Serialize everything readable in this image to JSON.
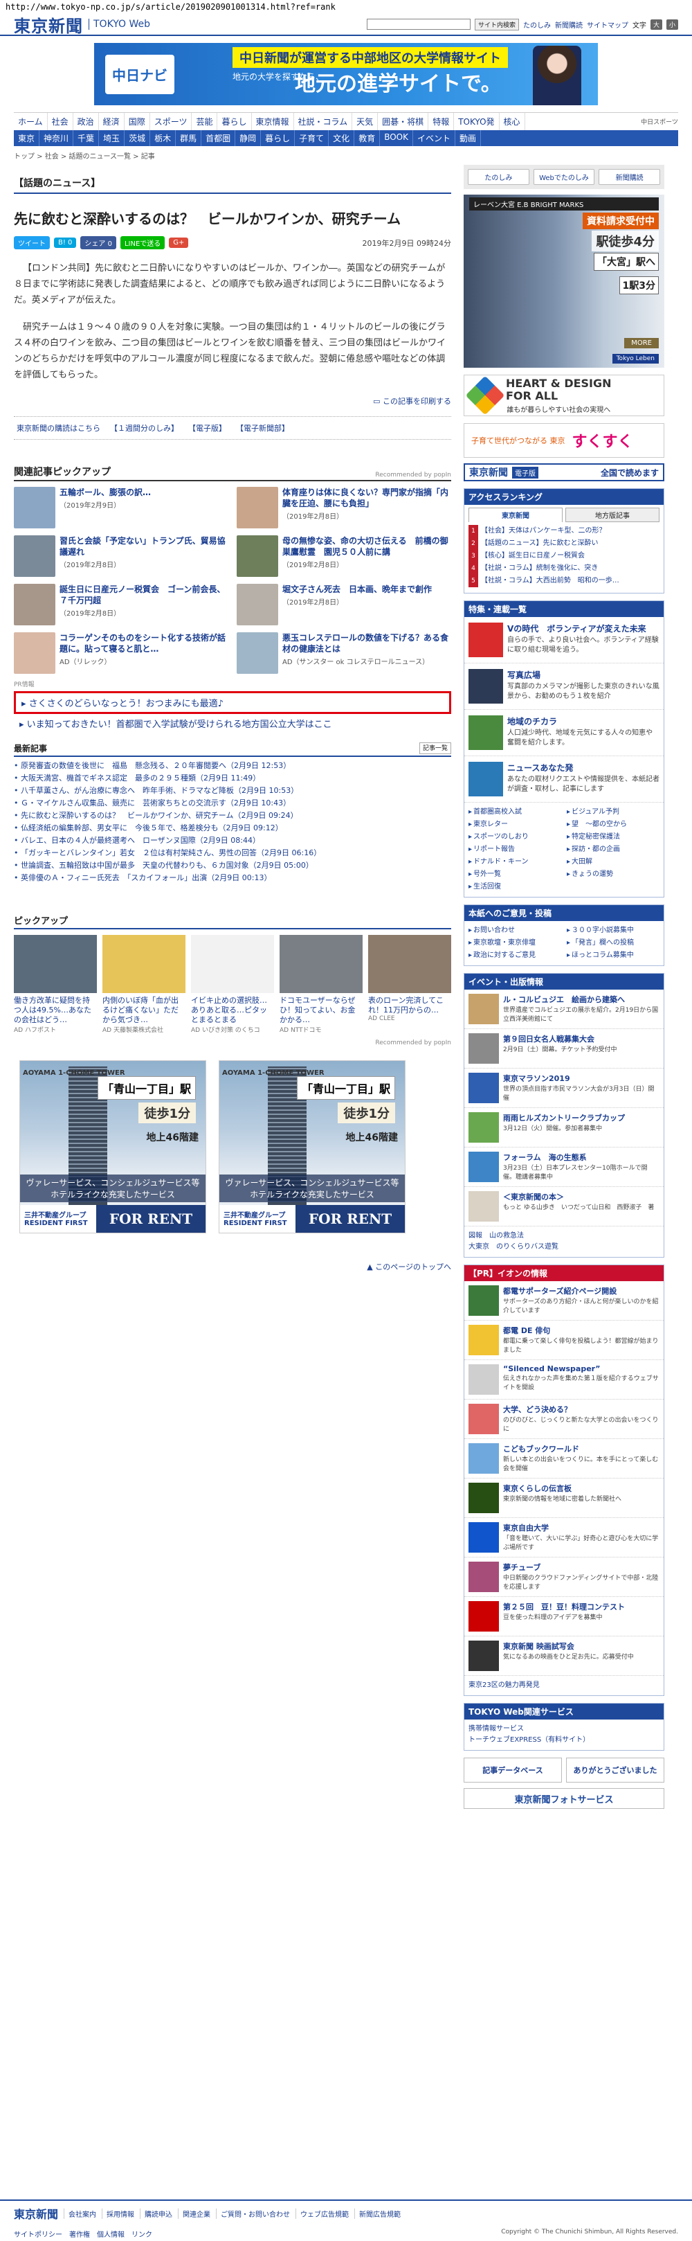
{
  "url": "http://www.tokyo-np.co.jp/s/article/2019020901001314.html?ref=rank",
  "header": {
    "logo": "東京新聞",
    "logo_web": "TOKYO Web",
    "search_button": "サイト内検索",
    "links": [
      "たのしみ",
      "新聞購読",
      "サイトマップ"
    ],
    "font_label": "文字",
    "font_large": "大",
    "font_small": "小"
  },
  "top_ad": {
    "logo": "中日ナビ",
    "headline": "中日新聞が運営する中部地区の大学情報サイト",
    "small": "地元の大学を探すなら、",
    "main": "地元の進学サイトで。"
  },
  "nav_primary": [
    "ホーム",
    "社会",
    "政治",
    "経済",
    "国際",
    "スポーツ",
    "芸能",
    "暮らし",
    "東京情報",
    "社説・コラム",
    "天気",
    "囲碁・将棋",
    "特報",
    "TOKYO発",
    "核心"
  ],
  "nav_primary_right": "中日スポーツ",
  "nav_secondary": [
    "東京",
    "神奈川",
    "千葉",
    "埼玉",
    "茨城",
    "栃木",
    "群馬",
    "首都圏",
    "静岡",
    "暮らし",
    "子育て",
    "文化",
    "教育",
    "BOOK",
    "イベント",
    "動画"
  ],
  "breadcrumb": "トップ > 社会 > 話題のニュース一覧 > 記事",
  "section": "【話題のニュース】",
  "article": {
    "title": "先に飲むと深酔いするのは？　ビールかワインか、研究チーム",
    "date": "2019年2月9日 09時24分",
    "paragraphs": [
      "【ロンドン共同】先に飲むと二日酔いになりやすいのはビールか、ワインか―。英国などの研究チームが８日までに学術誌に発表した調査結果によると、どの順序でも飲み過ぎれば同じように二日酔いになるようだ。英メディアが伝えた。",
      "研究チームは１９～４０歳の９０人を対象に実験。一つ目の集団は約１・４リットルのビールの後にグラス４杯の白ワインを飲み、二つ目の集団はビールとワインを飲む順番を替え、三つ目の集団はビールかワインのどちらかだけを呼気中のアルコール濃度が同じ程度になるまで飲んだ。翌朝に倦怠感や嘔吐などの体調を評価してもらった。"
    ],
    "print": "この記事を印刷する"
  },
  "share": {
    "tweet": "ツイート",
    "hatena": "B! 0",
    "facebook": "シェア 0",
    "line": "LINEで送る",
    "gplus": "G+"
  },
  "sub_links": [
    "東京新聞の購読はこちら",
    "【１週間分のしみ】",
    "【電子版】",
    "【電子新聞部】"
  ],
  "related": {
    "title": "関連記事ピックアップ",
    "recommend": "Recommended by popIn",
    "items": [
      {
        "title": "五輪ボール、膨張の訳…",
        "date": "（2019年2月9日）"
      },
      {
        "title": "体育座りは体に良くない？専門家が指摘「内臓を圧迫、腰にも負担」",
        "date": "（2019年2月8日）"
      },
      {
        "title": "習氏と会談「予定ない」トランプ氏、貿易協議遅れ",
        "date": "（2019年2月8日）"
      },
      {
        "title": "母の無惨な姿、命の大切さ伝える　前橋の御巣鷹慰霊　園児５０人前に講",
        "date": "（2019年2月8日）"
      },
      {
        "title": "誕生日に日産元ノー税質会　ゴーン前会長、７千万円超",
        "date": "（2019年2月8日）"
      },
      {
        "title": "堀文子さん死去　日本画、晩年まで創作",
        "date": "（2019年2月8日）"
      },
      {
        "title": "コラーゲンそのものをシート化する技術が話題に。貼って寝ると肌と…",
        "date": "AD（リレック）"
      },
      {
        "title": "悪玉コレステロールの数値を下げる？ある食材の健康法とは",
        "date": "AD（サンスター ok コレステロールニュース）"
      }
    ]
  },
  "pr": {
    "label": "PR情報",
    "line1": "さくさくのどらいなっとう！おつまみにも最適♪",
    "line2": "いま知っておきたい！首都圏で入学試験が受けられる地方国公立大学はここ"
  },
  "latest": {
    "title": "最新記事",
    "more": "記事一覧",
    "items": [
      "原発審査の数値を後世に　福島　懸念残る、２０年審閲要へ（2月9日 12:53）",
      "大阪天満宮、機首でギネス認定　最多の２９５種類（2月9日 11:49）",
      "八千草薫さん、がん治療に専念へ　昨年手術、ドラマなど降板（2月9日 10:53）",
      "Ｇ・マイケルさん収集品、競売に　芸術家ちちとの交流示す（2月9日 10:43）",
      "先に飲むと深酔いするのは？　ビールかワインか、研究チーム（2月9日 09:24）",
      "仏経済紙の編集幹部、男女平に　今後５年で、格差検分も（2月9日 09:12）",
      "バレエ、日本の４人が最終選考へ　ローザンヌ国際（2月9日 08:44）",
      "「ガッキーとバレンタイン」若女　２位は有村架純さん、男性の回答（2月9日 06:16）",
      "世論調査、五輪招致は中国が最多　天皇の代替わりも、６カ国対象（2月9日 05:00）",
      "英俳優のＡ・フィニー氏死去　「スカイフォール」出演（2月9日 00:13）"
    ]
  },
  "pickup": {
    "title": "ピックアップ",
    "items": [
      {
        "text": "働き方改革に疑問を持つ人は49.5%…あなたの会社はどう…",
        "src": "AD ハフポスト"
      },
      {
        "text": "内側のいぼ痔「血が出るけど痛くない」ただから気づき…",
        "src": "AD 天藤製薬株式会社"
      },
      {
        "text": "イビキ止めの選択肢…ありあと取る…ピタッとまるとまる",
        "src": "AD いびき対策 のくちコ"
      },
      {
        "text": "ドコモユーザーならぜひ！知ってよい、お金かかる…",
        "src": "AD NTTドコモ"
      },
      {
        "text": "表のローン完済してこれ！11万円からの…",
        "src": "AD CLEE"
      }
    ],
    "recommend": "Recommended by popIn"
  },
  "square_ads": {
    "area": "AOYAMA 1-CHOME TOWER",
    "station": "「青山一丁目」駅",
    "walk": "徒歩1分",
    "floors": "地上46階建",
    "services": "ヴァレーサービス、コンシェルジュサービス等",
    "services2": "ホテルライクな充実したサービス",
    "brand": "三井不動産グループ RESIDENT FIRST",
    "rent": "FOR RENT"
  },
  "page_top": "このページのトップへ",
  "right": {
    "buttons": [
      "たのしみ",
      "Webでたのしみ",
      "新聞購読"
    ],
    "building_ad": {
      "title": "レーベン大宮 E.B BRIGHT MARKS",
      "orange": "資料請求受付中",
      "walk": "駅徒歩4分",
      "station1": "「大宮」駅へ",
      "station2": "1駅3分",
      "more": "MORE",
      "brand": "Tokyo Leben"
    },
    "heart": {
      "line1": "HEART & DESIGN",
      "line2": "FOR ALL",
      "sub": "誰もが暮らしやすい社会の実現へ"
    },
    "sukusuku": {
      "text": "子育て世代がつながる 東京",
      "logo": "すくすく"
    },
    "denshi": {
      "logo": "東京新聞",
      "badge": "電子版",
      "link": "全国で読めます"
    },
    "ranking": {
      "title": "アクセスランキング",
      "tabs": [
        "東京新聞",
        "地方版記事"
      ],
      "items": [
        "【社会】天体はパンケーキ型、二の形？",
        "【話題のニュース】先に飲むと深酔い",
        "【核心】誕生日に日産ノー税質会",
        "【社説・コラム】統制を強化に、突き",
        "【社説・コラム】大西出前勢　昭和の一歩…"
      ]
    },
    "features": {
      "title": "特集・連載一覧",
      "items": [
        {
          "title": "Vの時代　ボランティアが変えた未来",
          "desc": "自らの手で、より良い社会へ。ボランティア経験に取り組む現場を追う。"
        },
        {
          "title": "写真広場",
          "desc": "写真部のカメラマンが撮影した東京のきれいな風景から、お勧めのもう１枚を紹介"
        },
        {
          "title": "地域のチカラ",
          "desc": "人口減少時代、地域を元気にする人々の知恵や奮闘を紹介します。"
        },
        {
          "title": "ニュースあなた発",
          "desc": "あなたの取材リクエストや情報提供を、本紙記者が調査・取材し、記事にします"
        }
      ],
      "links": [
        "首都圏高校入試",
        "ビジュアル予判",
        "東京レター",
        "望　～都の空から",
        "スポーツのしおり",
        "特定秘密保護法",
        "リポート報告",
        "探訪・都の企画",
        "ドナルド・キーン",
        "大田解",
        "号外一覧",
        "きょうの運勢",
        "生活回復"
      ]
    },
    "services": {
      "title": "本紙へのご意見・投稿",
      "links": [
        "お問い合わせ",
        "３００字小説募集中",
        "東京歌壇・東京俳壇",
        "「発言」欄への投稿",
        "政治に対するご意見",
        "ほっとコラム募集中"
      ]
    },
    "events": {
      "title": "イベント・出版情報",
      "items": [
        {
          "title": "ル・コルビュジエ　絵画から建築へ",
          "desc": "世界遺産でコルビュジエの展示を紹介。2月19日から国立西洋美術館にて"
        },
        {
          "title": "第９回日女名人戦募集大会",
          "desc": "2月9日（土）開幕。チケット予約受付中"
        },
        {
          "title": "東京マラソン2019",
          "desc": "世界の頂点目指す市民マラソン大会が3月3日（日）開催"
        },
        {
          "title": "雨雨ヒルズカントリークラブカップ",
          "desc": "3月12日（火）開催。参加者募集中"
        },
        {
          "title": "フォーラム　海の生態系",
          "desc": "3月23日（土）日本プレスセンター10階ホールで開催。聴講者募集中"
        },
        {
          "title": "＜東京新聞の本＞",
          "desc": "もっと ゆる山歩き　いつだって山日和　西野淑子　著"
        }
      ],
      "links": [
        "図報　山の救急法",
        "大東京　のりくらりバス遊覧"
      ]
    },
    "ion": {
      "title": "【PR】イオンの情報",
      "items": [
        {
          "title": "都電サポーターズ紹介ページ開設",
          "desc": "サポーターズのあり方紹介・ほんと何が楽しいのかを紹介しています"
        },
        {
          "title": "都電 DE 俳句",
          "desc": "都電に乗って楽しく俳句を投稿しよう！都営線が始まりました"
        },
        {
          "title": "“Silenced Newspaper”",
          "desc": "伝えきれなかった声を集めた第１版を紹介するウェブサイトを開設"
        },
        {
          "title": "大学、どう決める？",
          "desc": "のびのびと、じっくりと新たな大学との出会いをつくりに"
        },
        {
          "title": "こどもブックワールド",
          "desc": "新しい本との出会いをつくりに。本を手にとって楽しむ会を開催"
        },
        {
          "title": "東京くらしの伝言板",
          "desc": "東京新聞の情報を地域に密着した新聞社へ"
        },
        {
          "title": "東京自由大学",
          "desc": "「音を聴いて、大いに学ぶ」好奇心と遊び心を大切に学ぶ場所です"
        },
        {
          "title": "夢チューブ",
          "desc": "中日新聞のクラウドファンディングサイトで中部・北陸を応援します"
        },
        {
          "title": "第２５回　豆！豆！料理コンテスト",
          "desc": "豆を使った料理のアイデアを募集中"
        },
        {
          "title": "東京新聞 映画試写会",
          "desc": "気になるあの映画をひと足お先に。応募受付中"
        }
      ],
      "footer_link": "東京23区の魅力再発見"
    },
    "web_services": {
      "title": "TOKYO Web関連サービス",
      "links": [
        "携帯情報サービス",
        "トーチウェブEXPRESS（有料サイト）"
      ]
    },
    "bottom_banners": [
      "記事データベース",
      "ありがとうございました"
    ],
    "photo_banner": "東京新聞フォトサービス"
  },
  "footer": {
    "logo": "東京新聞",
    "links": [
      "会社案内",
      "採用情報",
      "購読申込",
      "関連企業",
      "ご質問・お問い合わせ",
      "ウェブ広告規範",
      "新聞広告規範"
    ],
    "links2": [
      "サイトポリシー",
      "著作権",
      "個人情報",
      "リンク"
    ],
    "copyright": "Copyright © The Chunichi Shimbun, All Rights Reserved."
  }
}
